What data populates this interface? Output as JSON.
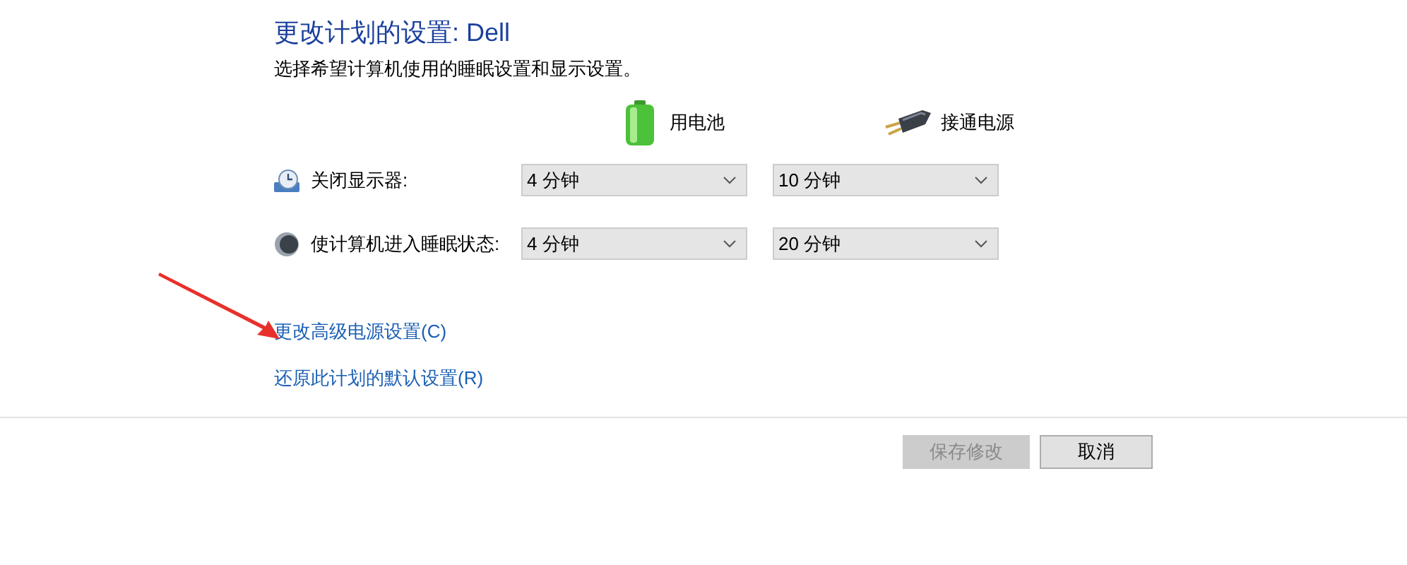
{
  "title": "更改计划的设置: Dell",
  "subtitle": "选择希望计算机使用的睡眠设置和显示设置。",
  "columns": [
    {
      "kind": "battery",
      "label": "用电池"
    },
    {
      "kind": "plugged",
      "label": "接通电源"
    }
  ],
  "settings": [
    {
      "kind": "display",
      "label": "关闭显示器:",
      "values": [
        "4 分钟",
        "10 分钟"
      ]
    },
    {
      "kind": "sleep",
      "label": "使计算机进入睡眠状态:",
      "values": [
        "4 分钟",
        "20 分钟"
      ]
    }
  ],
  "links": [
    "更改高级电源设置(C)",
    "还原此计划的默认设置(R)"
  ],
  "buttons": [
    {
      "label": "保存修改",
      "disabled": true
    },
    {
      "label": "取消",
      "disabled": false
    }
  ]
}
